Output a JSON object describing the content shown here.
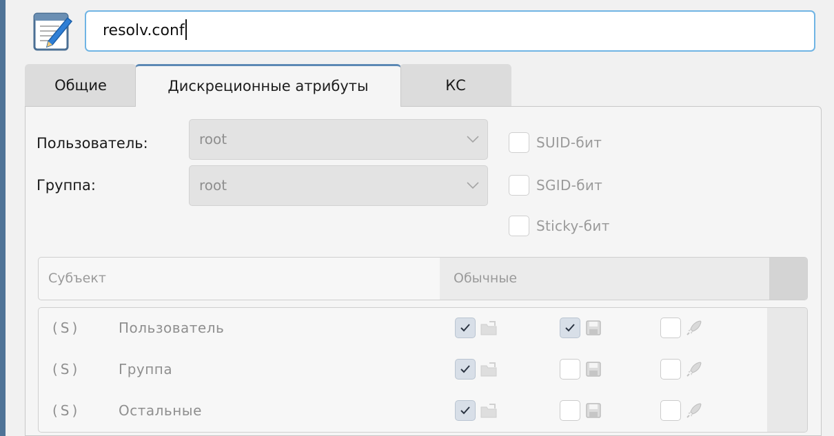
{
  "file": {
    "name": "resolv.conf",
    "icon": "text-editor-icon"
  },
  "tabs": [
    {
      "label": "Общие",
      "active": false
    },
    {
      "label": "Дискреционные атрибуты",
      "active": true
    },
    {
      "label": "КС",
      "active": false
    }
  ],
  "owner": {
    "user_label": "Пользователь:",
    "user_value": "root",
    "group_label": "Группа:",
    "group_value": "root"
  },
  "flags": {
    "suid": {
      "label": "SUID-бит",
      "checked": false
    },
    "sgid": {
      "label": "SGID-бит",
      "checked": false
    },
    "sticky": {
      "label": "Sticky-бит",
      "checked": false
    }
  },
  "table": {
    "headers": {
      "subject": "Субъект",
      "regular": "Обычные"
    },
    "rows": [
      {
        "prefix": "(S)",
        "subject": "Пользователь",
        "read": true,
        "write": true,
        "exec": false
      },
      {
        "prefix": "(S)",
        "subject": "Группа",
        "read": true,
        "write": false,
        "exec": false
      },
      {
        "prefix": "(S)",
        "subject": "Остальные",
        "read": true,
        "write": false,
        "exec": false
      }
    ],
    "permission_icons": {
      "read": "folder-read-icon",
      "write": "floppy-disk-icon",
      "exec": "rocket-icon"
    }
  },
  "colors": {
    "accent": "#5b88b4",
    "input_focus": "#6fb4e4",
    "side_strip": "#4f7397"
  }
}
